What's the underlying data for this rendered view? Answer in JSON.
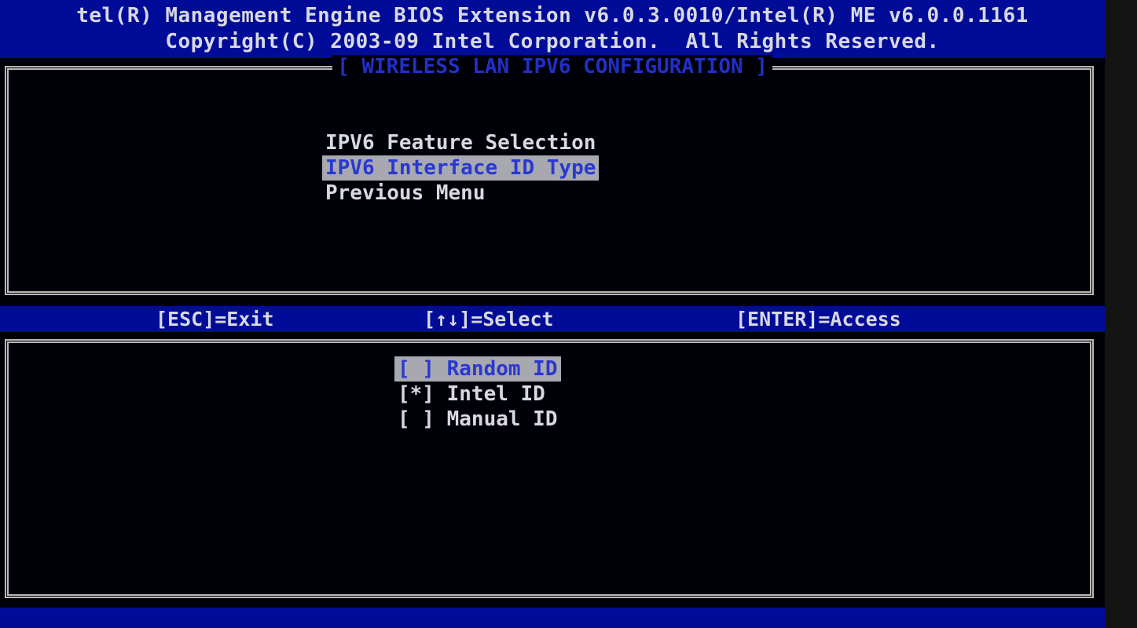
{
  "header": {
    "line1": "tel(R) Management Engine BIOS Extension v6.0.3.0010/Intel(R) ME v6.0.0.1161",
    "line2": "Copyright(C) 2003-09 Intel Corporation.  All Rights Reserved."
  },
  "panel_title": "[ WIRELESS LAN IPV6 CONFIGURATION ]",
  "menu": {
    "items": [
      {
        "label": "IPV6 Feature Selection",
        "selected": false
      },
      {
        "label": "IPV6 Interface ID Type",
        "selected": true
      },
      {
        "label": "Previous Menu",
        "selected": false
      }
    ]
  },
  "keybar": {
    "exit": "[ESC]=Exit",
    "select": "[↑↓]=Select",
    "access": "[ENTER]=Access"
  },
  "options": {
    "items": [
      {
        "label": "[ ] Random ID",
        "selected": true
      },
      {
        "label": "[*] Intel ID",
        "selected": false
      },
      {
        "label": "[ ] Manual ID",
        "selected": false
      }
    ]
  },
  "colors": {
    "bar_blue": "#000c98",
    "highlight_bg": "#a8a8b0",
    "highlight_text": "#2838d0",
    "text": "#d8d8e0",
    "title_text": "#2030c8"
  }
}
